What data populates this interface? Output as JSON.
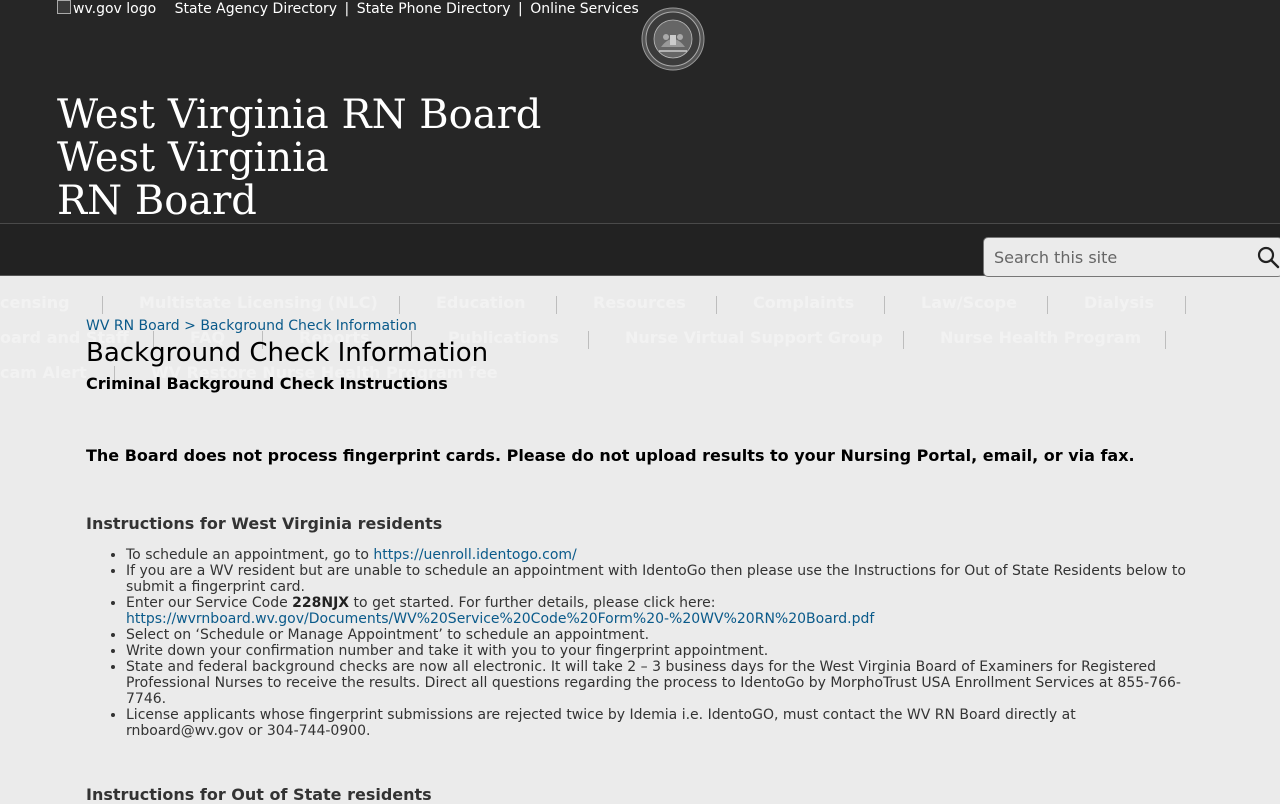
{
  "topbar": {
    "logo_alt": "wv.gov logo",
    "links": [
      "State Agency Directory",
      "State Phone Directory",
      "Online Services"
    ],
    "separator": "|"
  },
  "site_title": {
    "line1": "West Virginia RN Board",
    "line2": "West Virginia",
    "line3": "RN Board"
  },
  "search": {
    "placeholder": "Search this site",
    "icon": "search-icon"
  },
  "menu": {
    "row1": [
      "censing",
      "Multistate Licensing (NLC)",
      "Education",
      "Resources",
      "Complaints",
      "Law/Scope",
      "Dialysis"
    ],
    "row2": [
      "oard and Staff",
      "FAQ",
      "Reports",
      "Publications",
      "Nurse Virtual Support Group",
      "Nurse Health Program"
    ],
    "row3": [
      "cam Alert",
      "WV Restore Nurse Health Program fee"
    ]
  },
  "breadcrumb": {
    "home": "WV RN Board",
    "separator": ">",
    "current": "Background Check Information"
  },
  "page": {
    "title": "Background Check Information",
    "subtitle": "Criminal Background Check Instructions",
    "notice": "The Board does not process fingerprint cards.  Please do not upload results to your Nursing Portal, email, or via fax."
  },
  "wv_section": {
    "heading": "Instructions for West Virginia residents",
    "item1_text": "To schedule an appointment, go to ",
    "item1_link": "https://uenroll.identogo.com/",
    "item2": "If you are a WV resident but are unable to schedule an appointment with IdentoGo then please use the Instructions for Out of State Residents below to submit a fingerprint card.",
    "item3_pre": "Enter our Service Code ",
    "item3_code": "228NJX",
    "item3_post": " to get started. For further details, please click here:",
    "item3_link": "https://wvrnboard.wv.gov/Documents/WV%20Service%20Code%20Form%20-%20WV%20RN%20Board.pdf",
    "item4": "Select on ‘Schedule or Manage Appointment’ to schedule an appointment.",
    "item5": "Write down your confirmation number and take it with you to your fingerprint appointment.",
    "item6": "State and federal background checks are now all electronic.  It will take 2 – 3 business days for the West Virginia Board of Examiners for Registered Professional Nurses to receive the results.  Direct all questions regarding the process to IdentoGo by MorphoTrust USA Enrollment Services at 855-766-7746.",
    "item7": "License applicants whose fingerprint submissions are rejected twice by Idemia i.e. IdentoGO, must contact the WV RN Board directly at rnboard@wv.gov or 304-744-0900."
  },
  "oos_section": {
    "heading": "Instructions for Out of State residents"
  },
  "colors": {
    "header_bg": "#262626",
    "page_bg": "#ebebeb",
    "link": "#0a5a8a"
  }
}
